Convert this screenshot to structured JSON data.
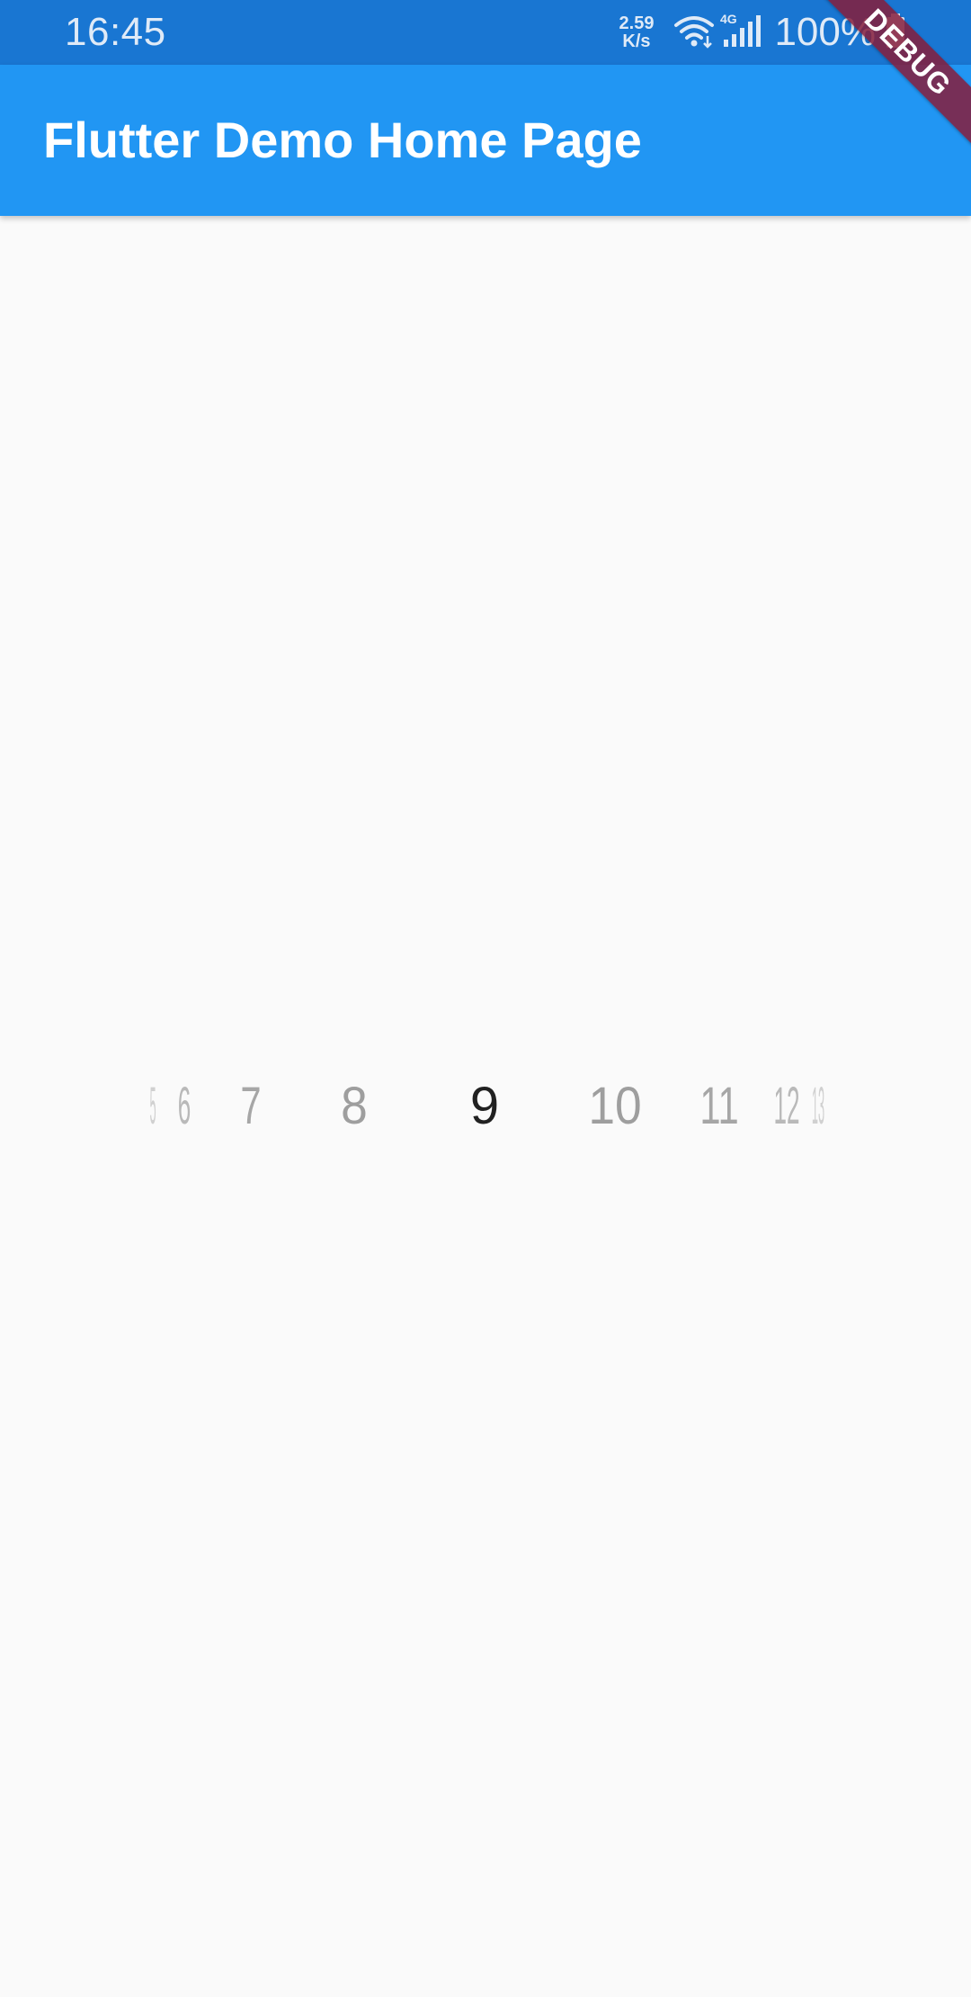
{
  "status_bar": {
    "time": "16:45",
    "net_speed_value": "2.59",
    "net_speed_unit": "K/s",
    "network_type": "4G",
    "battery": "100%",
    "icons": [
      "wifi-icon",
      "signal-icon",
      "battery-icon"
    ]
  },
  "app_bar": {
    "title": "Flutter Demo Home Page"
  },
  "debug_banner": {
    "label": "DEBUG"
  },
  "picker": {
    "selected": "9",
    "items": [
      "5",
      "6",
      "7",
      "8",
      "9",
      "10",
      "11",
      "12",
      "13"
    ]
  },
  "colors": {
    "status_bar": "#1976d2",
    "app_bar": "#2196f3",
    "background": "#fafafa",
    "selected_text": "#212121",
    "unselected_text": "#9e9e9e",
    "debug_banner": "#861d3b"
  }
}
